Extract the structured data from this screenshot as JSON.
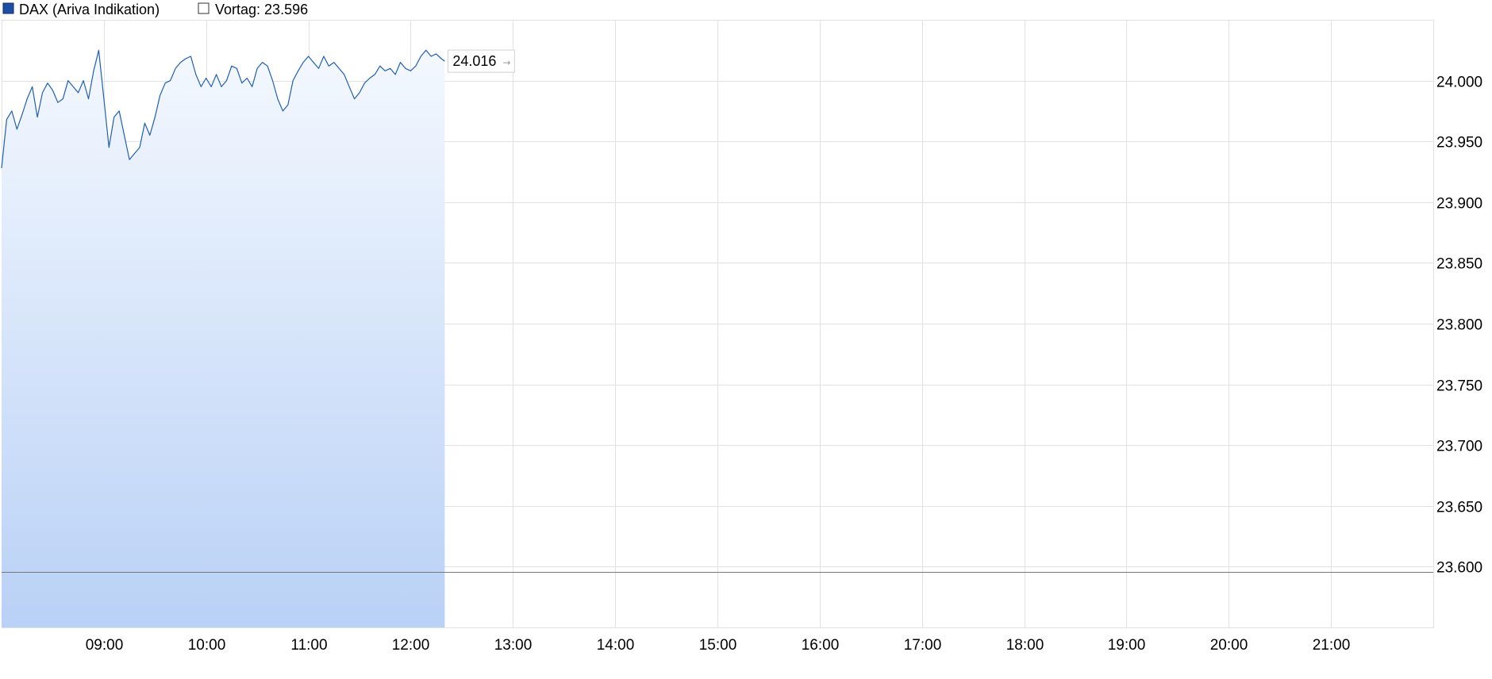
{
  "legend": {
    "series_label": "DAX (Ariva Indikation)",
    "prev_label": "Vortag: 23.596"
  },
  "colors": {
    "line": "#1f5fb8",
    "swatch": "#1a4fa3",
    "fill_top": "#f4f8fe",
    "fill_bottom": "#b9d1f6",
    "grid": "#e2e2e2",
    "prev_line": "#777777"
  },
  "chart_data": {
    "type": "area",
    "series": [
      {
        "name": "DAX (Ariva Indikation)",
        "x": [
          "08:00",
          "08:03",
          "08:06",
          "08:09",
          "08:12",
          "08:15",
          "08:18",
          "08:21",
          "08:24",
          "08:27",
          "08:30",
          "08:33",
          "08:36",
          "08:39",
          "08:42",
          "08:45",
          "08:48",
          "08:51",
          "08:54",
          "08:57",
          "09:00",
          "09:03",
          "09:06",
          "09:09",
          "09:12",
          "09:15",
          "09:18",
          "09:21",
          "09:24",
          "09:27",
          "09:30",
          "09:33",
          "09:36",
          "09:39",
          "09:42",
          "09:45",
          "09:48",
          "09:51",
          "09:54",
          "09:57",
          "10:00",
          "10:03",
          "10:06",
          "10:09",
          "10:12",
          "10:15",
          "10:18",
          "10:21",
          "10:24",
          "10:27",
          "10:30",
          "10:33",
          "10:36",
          "10:39",
          "10:42",
          "10:45",
          "10:48",
          "10:51",
          "10:54",
          "10:57",
          "11:00",
          "11:03",
          "11:06",
          "11:09",
          "11:12",
          "11:15",
          "11:18",
          "11:21",
          "11:24",
          "11:27",
          "11:30",
          "11:33",
          "11:36",
          "11:39",
          "11:42",
          "11:45",
          "11:48",
          "11:51",
          "11:54",
          "11:57",
          "12:00",
          "12:03",
          "12:06",
          "12:09",
          "12:12",
          "12:15",
          "12:18",
          "12:20"
        ],
        "values": [
          23928,
          23968,
          23975,
          23960,
          23972,
          23985,
          23995,
          23970,
          23990,
          23998,
          23992,
          23982,
          23985,
          24000,
          23995,
          23990,
          24000,
          23985,
          24008,
          24025,
          23985,
          23945,
          23970,
          23975,
          23955,
          23935,
          23940,
          23945,
          23965,
          23955,
          23970,
          23988,
          23998,
          24000,
          24010,
          24015,
          24018,
          24020,
          24005,
          23995,
          24002,
          23995,
          24005,
          23995,
          24000,
          24012,
          24010,
          23998,
          24002,
          23995,
          24010,
          24015,
          24012,
          24000,
          23985,
          23975,
          23980,
          24000,
          24008,
          24015,
          24020,
          24015,
          24010,
          24020,
          24012,
          24015,
          24010,
          24005,
          23995,
          23985,
          23990,
          23998,
          24002,
          24005,
          24012,
          24008,
          24010,
          24005,
          24015,
          24010,
          24008,
          24012,
          24020,
          24025,
          24020,
          24022,
          24018,
          24016
        ]
      }
    ],
    "x_ticks": [
      "09:00",
      "10:00",
      "11:00",
      "12:00",
      "13:00",
      "14:00",
      "15:00",
      "16:00",
      "17:00",
      "18:00",
      "19:00",
      "20:00",
      "21:00"
    ],
    "y_ticks": [
      "24.000",
      "23.950",
      "23.900",
      "23.850",
      "23.800",
      "23.750",
      "23.700",
      "23.650",
      "23.600"
    ],
    "y_tick_values": [
      24000,
      23950,
      23900,
      23850,
      23800,
      23750,
      23700,
      23650,
      23600
    ],
    "ylim": [
      23550,
      24050
    ],
    "xlim": [
      "08:00",
      "22:00"
    ],
    "prev_close": 23596,
    "last_value_label": "24.016",
    "grid": true,
    "legend_position": "top-left"
  }
}
